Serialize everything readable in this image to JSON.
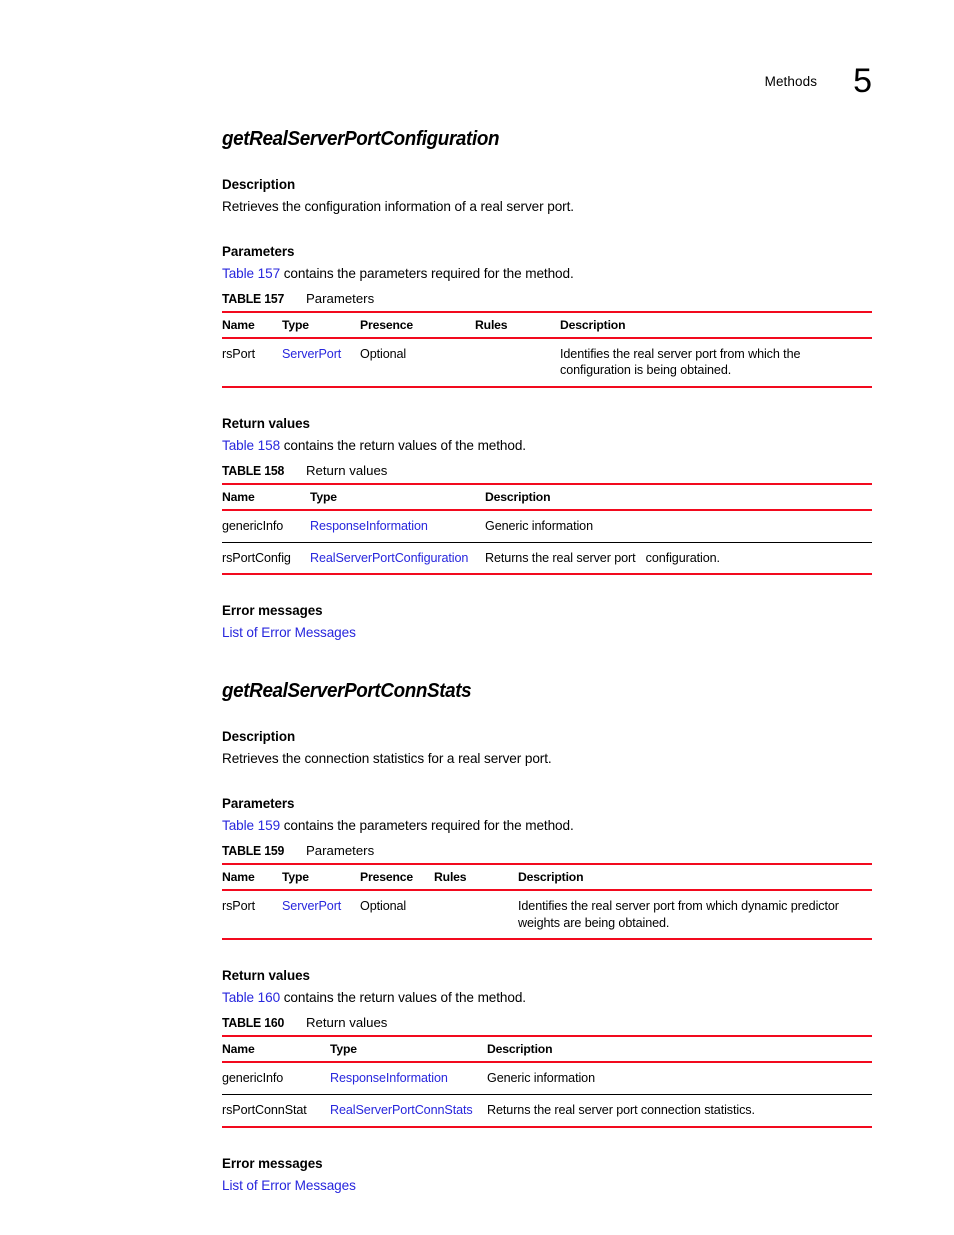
{
  "header": {
    "running_text": "Methods",
    "chapter_number": "5"
  },
  "colors": {
    "rule_red": "#f20a1e",
    "link_blue": "#2726dd",
    "text": "#000000",
    "page_background": "#ffffff"
  },
  "sections": [
    {
      "title": "getRealServerPortConfiguration",
      "description_heading": "Description",
      "description_text": "Retrieves the configuration information of a real server port.",
      "parameters_heading": "Parameters",
      "parameters_intro_link": "Table 157",
      "parameters_intro_rest": " contains the parameters required for the method.",
      "parameters_table": {
        "label": "TABLE 157",
        "title": "Parameters",
        "columns": [
          "Name",
          "Type",
          "Presence",
          "Rules",
          "Description"
        ],
        "rows": [
          {
            "name": "rsPort",
            "type": "ServerPort",
            "type_is_link": true,
            "presence": "Optional",
            "rules": "",
            "description": "Identifies the real server port from which the configuration is being obtained."
          }
        ]
      },
      "return_heading": "Return values",
      "return_intro_link": "Table 158",
      "return_intro_rest": " contains the return values of the method.",
      "return_table": {
        "label": "TABLE 158",
        "title": "Return values",
        "columns": [
          "Name",
          "Type",
          "Description"
        ],
        "rows": [
          {
            "name": "genericInfo",
            "type": "ResponseInformation",
            "type_is_link": true,
            "description": "Generic information"
          },
          {
            "name": "rsPortConfig",
            "type": "RealServerPortConfiguration",
            "type_is_link": true,
            "description": "Returns the real server port   configuration."
          }
        ]
      },
      "error_heading": "Error messages",
      "error_link": "List of Error Messages"
    },
    {
      "title": "getRealServerPortConnStats",
      "description_heading": "Description",
      "description_text": "Retrieves the connection statistics for a real server port.",
      "parameters_heading": "Parameters",
      "parameters_intro_link": "Table 159",
      "parameters_intro_rest": " contains the parameters required for the method.",
      "parameters_table": {
        "label": "TABLE 159",
        "title": "Parameters",
        "columns": [
          "Name",
          "Type",
          "Presence",
          "Rules",
          "Description"
        ],
        "rows": [
          {
            "name": "rsPort",
            "type": "ServerPort",
            "type_is_link": true,
            "presence": "Optional",
            "rules": "",
            "description": "Identifies the real server port from which dynamic predictor weights are being obtained."
          }
        ]
      },
      "return_heading": "Return values",
      "return_intro_link": "Table 160",
      "return_intro_rest": " contains the return values of the method.",
      "return_table": {
        "label": "TABLE 160",
        "title": "Return values",
        "columns": [
          "Name",
          "Type",
          "Description"
        ],
        "rows": [
          {
            "name": "genericInfo",
            "type": "ResponseInformation",
            "type_is_link": true,
            "description": "Generic information"
          },
          {
            "name": "rsPortConnStat",
            "type": "RealServerPortConnStats",
            "type_is_link": true,
            "description": "Returns the real server port connection statistics."
          }
        ]
      },
      "error_heading": "Error messages",
      "error_link": "List of Error Messages"
    }
  ]
}
